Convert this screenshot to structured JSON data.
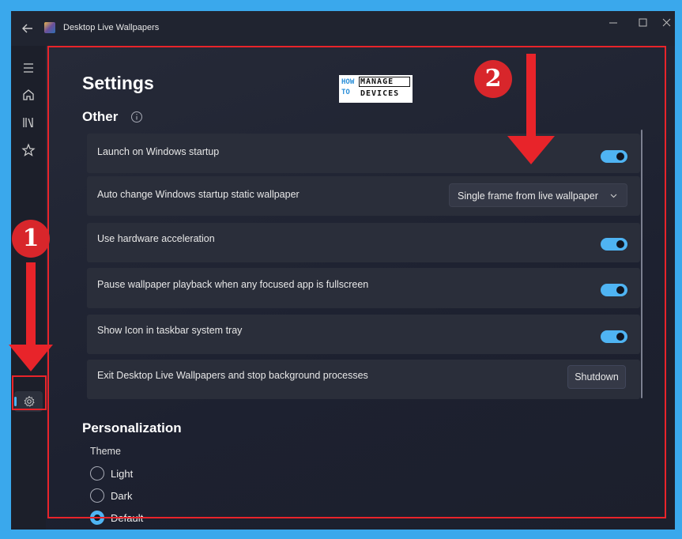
{
  "window": {
    "title": "Desktop Live Wallpapers",
    "icons": {
      "back": "back-arrow-icon",
      "minimize": "minimize-icon",
      "maximize": "maximize-icon",
      "close": "close-icon"
    }
  },
  "nav": {
    "items": [
      {
        "name": "menu",
        "icon": "hamburger-icon"
      },
      {
        "name": "home",
        "icon": "home-icon"
      },
      {
        "name": "library",
        "icon": "library-icon"
      },
      {
        "name": "favorites",
        "icon": "star-icon"
      },
      {
        "name": "settings",
        "icon": "gear-icon",
        "selected": true
      }
    ]
  },
  "page": {
    "title": "Settings"
  },
  "other": {
    "title": "Other",
    "info_icon": "info-icon",
    "rows": [
      {
        "label": "Launch on Windows startup",
        "control": "toggle",
        "on": true
      },
      {
        "label": "Auto change Windows startup static wallpaper",
        "control": "dropdown",
        "value": "Single frame from live wallpaper"
      },
      {
        "label": "Use hardware acceleration",
        "control": "toggle",
        "on": true
      },
      {
        "label": "Pause wallpaper playback when any focused app is fullscreen",
        "control": "toggle",
        "on": true
      },
      {
        "label": "Show Icon in taskbar system tray",
        "control": "toggle",
        "on": true
      },
      {
        "label": "Exit Desktop Live Wallpapers and stop background processes",
        "control": "button",
        "button_label": "Shutdown"
      }
    ]
  },
  "personalization": {
    "title": "Personalization",
    "theme_label": "Theme",
    "options": [
      {
        "label": "Light",
        "checked": false
      },
      {
        "label": "Dark",
        "checked": false
      },
      {
        "label": "Default",
        "checked": true
      }
    ]
  },
  "watermark": {
    "how": "HOW",
    "to": "TO",
    "manage": "MANAGE",
    "devices": "DEVICES"
  },
  "annotations": {
    "marker_1": "1",
    "marker_2": "2",
    "color": "#e8242a"
  },
  "colors": {
    "accent": "#4fb4f3",
    "background": "#3aa8ec",
    "window": "#1f2330",
    "row": "#2a2e3a"
  }
}
